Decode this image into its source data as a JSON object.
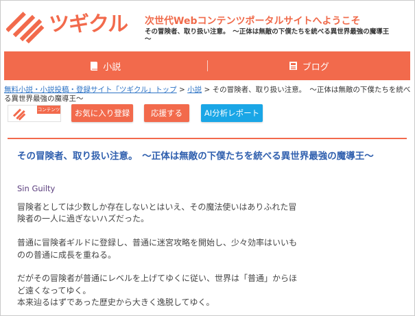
{
  "brand": {
    "logo_text": "ツギクル",
    "logo_icon": "stripes-logo-icon",
    "accent": "#f26a4c"
  },
  "header": {
    "tagline": "次世代Webコンテンツポータルサイトへようこそ",
    "site_desc": "その冒険者、取り扱い注意。　～正体は無敵の下僕たちを統べる異世界最強の魔導王～"
  },
  "nav": {
    "items": [
      {
        "label": "小説",
        "icon": "book-icon"
      },
      {
        "label": "ブログ",
        "icon": "blog-icon"
      }
    ]
  },
  "breadcrumb": {
    "crumbs": [
      "無料小説・小説投稿・登録サイト「ツギクル」トップ",
      "小説"
    ],
    "current": "その冒険者、取り扱い注意。　～正体は無敵の下僕たちを統べる異世界最強の魔導王～"
  },
  "actions": {
    "badge_text": "コンテンツ",
    "favorite": "お気に入り登録",
    "cheer": "応援する",
    "ai_report": "AI分析レポート",
    "ai_color": "#1aa6e6"
  },
  "work": {
    "title": "その冒険者、取り扱い注意。　～正体は無敵の下僕たちを統べる異世界最強の魔導王～",
    "author": "Sin Guilty",
    "paragraphs": [
      "冒険者としては少数しか存在しないとはいえ、その魔法使いはありふれた冒\n険者の一人に過ぎないハズだった。",
      "普通に冒険者ギルドに登録し、普通に迷宮攻略を開始し、少々効率はいいも\nのの普通に成長を重ねる。",
      "だがその冒険者が普通にレベルを上げてゆくに従い、世界は「普通」からほ\nど遠くなってゆく。\n本来辿るはずであった歴史から大きく逸脱してゆく。"
    ]
  }
}
